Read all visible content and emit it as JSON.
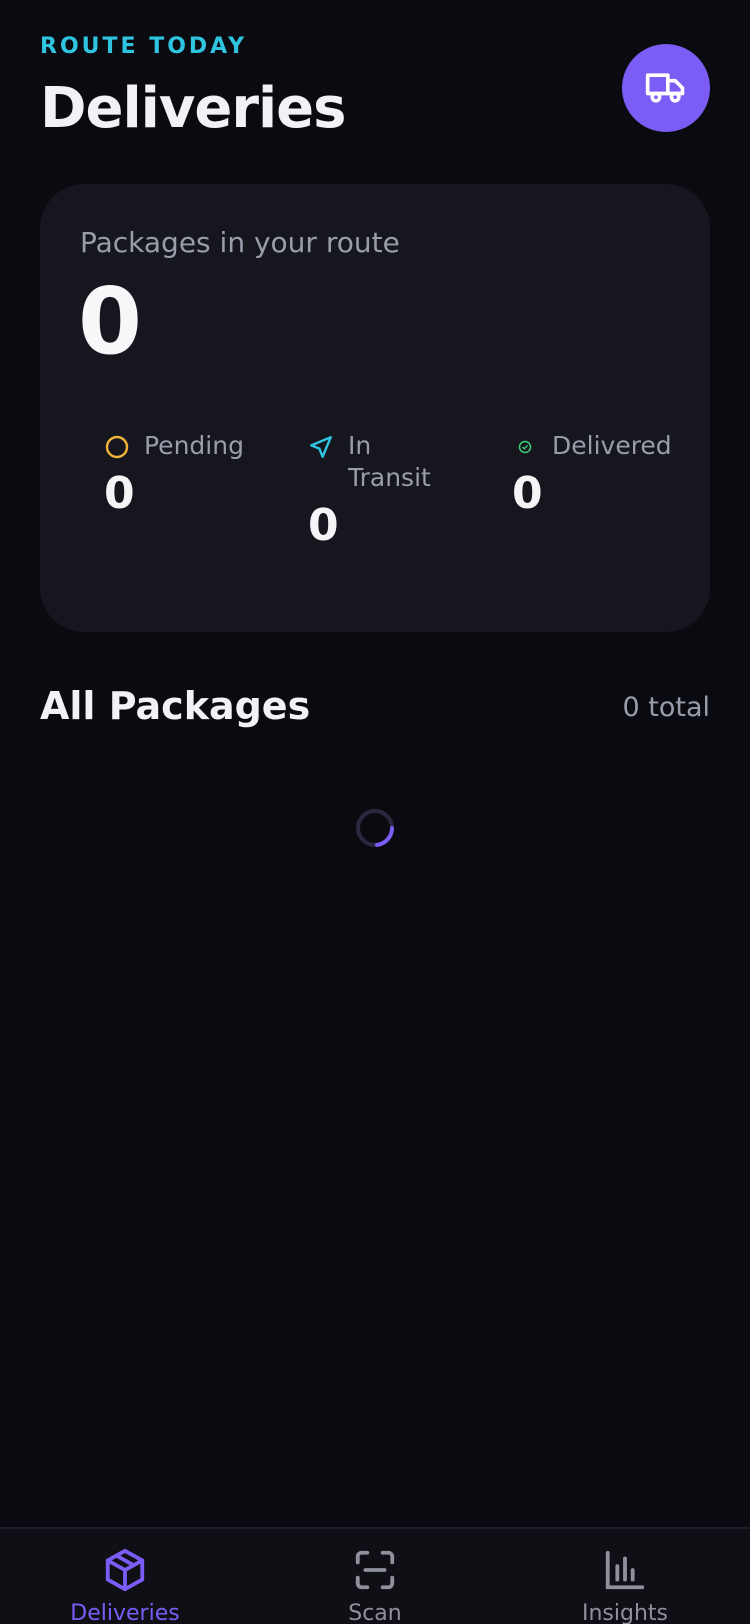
{
  "header": {
    "eyebrow": "ROUTE TODAY",
    "title": "Deliveries",
    "action_icon": "truck-icon"
  },
  "summary": {
    "label": "Packages in your route",
    "count": "0",
    "stats": [
      {
        "label": "Pending",
        "value": "0",
        "icon": "circle-icon",
        "color": "#f2b53a"
      },
      {
        "label": "In Transit",
        "value": "0",
        "icon": "navigation-arrow-icon",
        "color": "#2fc4e0"
      },
      {
        "label": "Delivered",
        "value": "0",
        "icon": "check-circle-icon",
        "color": "#3bd17a"
      }
    ]
  },
  "packages": {
    "title": "All Packages",
    "count_label": "0 total"
  },
  "nav": {
    "items": [
      {
        "label": "Deliveries",
        "icon": "package-icon",
        "active": true
      },
      {
        "label": "Scan",
        "icon": "scan-icon",
        "active": false
      },
      {
        "label": "Insights",
        "icon": "bar-chart-icon",
        "active": false
      }
    ]
  },
  "colors": {
    "accent": "#7b5cf5",
    "eyebrow": "#2fc4e0",
    "background": "#0a0b10",
    "card": "#16161f"
  }
}
